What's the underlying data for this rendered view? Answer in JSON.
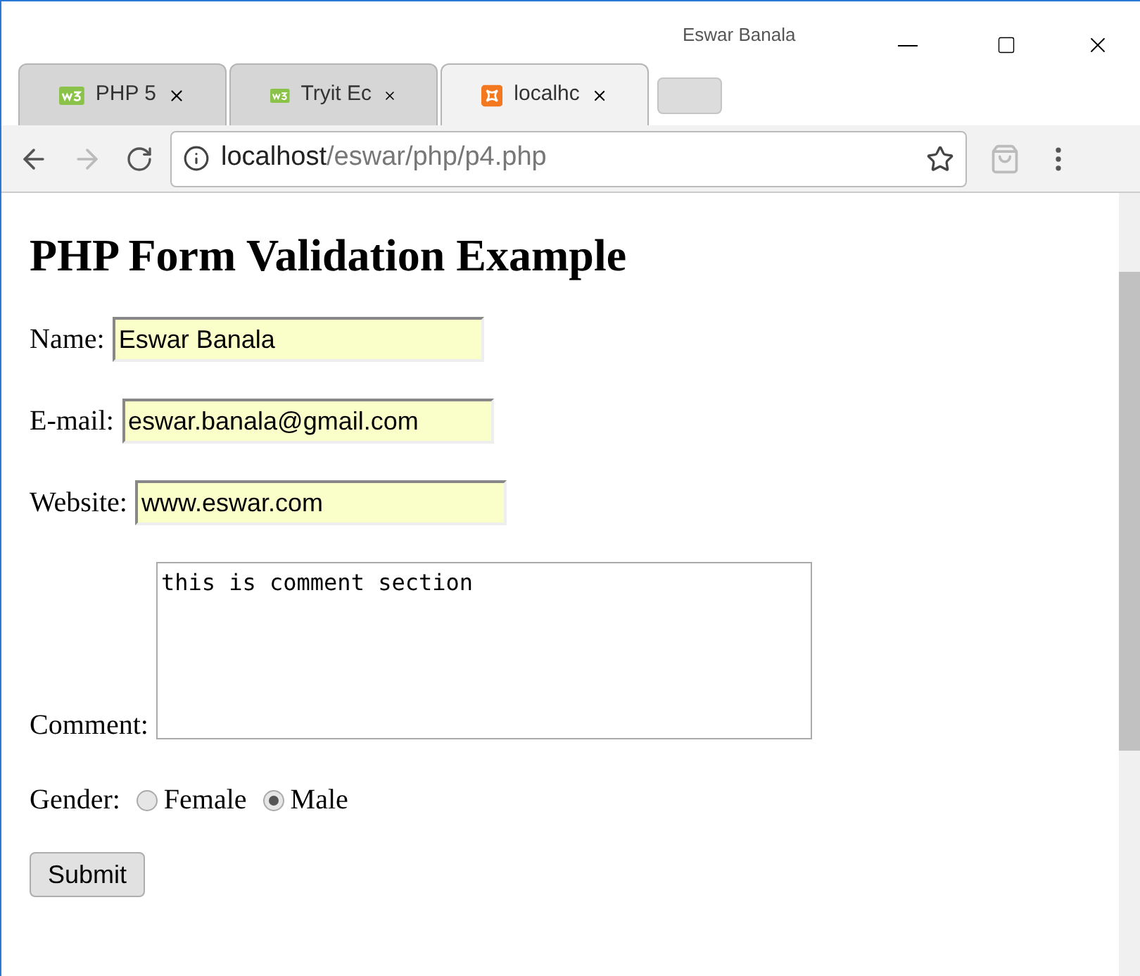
{
  "window": {
    "user": "Eswar Banala"
  },
  "tabs": [
    {
      "label": "PHP 5",
      "kind": "w3",
      "selected": false
    },
    {
      "label": "Tryit Ec",
      "kind": "w3",
      "selected": false
    },
    {
      "label": "localhc",
      "kind": "xampp",
      "selected": true
    }
  ],
  "address_bar": {
    "host": "localhost",
    "path": "/eswar/php/p4.php"
  },
  "page": {
    "heading": "PHP Form Validation Example",
    "fields": [
      {
        "label": "Name:",
        "value": "Eswar Banala"
      },
      {
        "label": "E-mail:",
        "value": "eswar.banala@gmail.com"
      },
      {
        "label": "Website:",
        "value": "www.eswar.com"
      }
    ],
    "comment": {
      "label": "Comment:",
      "value": "this is comment section"
    },
    "gender": {
      "label": "Gender:",
      "options": [
        {
          "label": "Female",
          "selected": false
        },
        {
          "label": "Male",
          "selected": true
        }
      ]
    },
    "submit": "Submit"
  }
}
